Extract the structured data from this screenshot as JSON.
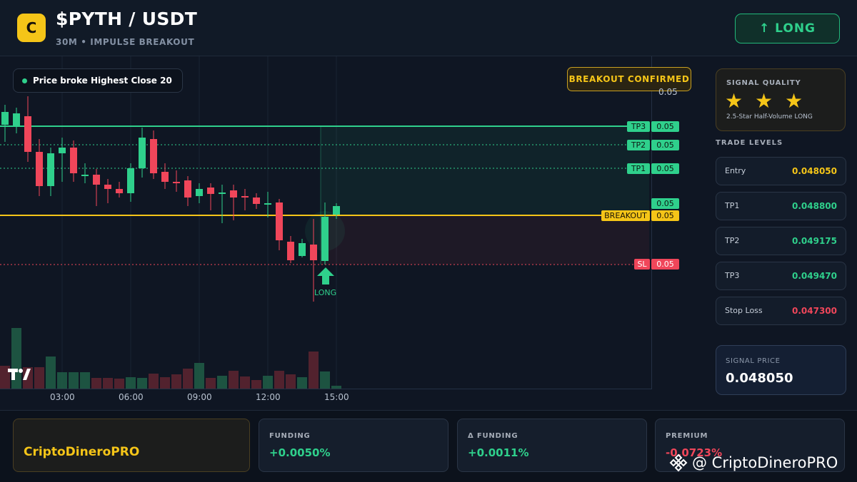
{
  "header": {
    "logo_letter": "C",
    "pair": "$PYTH / USDT",
    "subtitle": "30M • IMPULSE BREAKOUT",
    "direction_button": "↑ LONG"
  },
  "chart": {
    "notice": "Price broke Highest Close 20",
    "badge": "BREAKOUT CONFIRMED",
    "top_price_label": "0.05",
    "time_ticks": [
      "03:00",
      "06:00",
      "09:00",
      "12:00",
      "15:00"
    ],
    "lines": [
      {
        "name": "TP3",
        "label": "TP3",
        "value": "0.05",
        "color": "#2fd08c"
      },
      {
        "name": "TP2",
        "label": "TP2",
        "value": "0.05",
        "color": "#2fd08c"
      },
      {
        "name": "TP1",
        "label": "TP1",
        "value": "0.05",
        "color": "#2fd08c"
      },
      {
        "name": "breakout",
        "label": "BREAKOUT",
        "value": "0.05",
        "color": "#f5c518"
      },
      {
        "name": "sl",
        "label": "SL",
        "value": "0.05",
        "color": "#f0465a"
      }
    ],
    "current_price_label": "0.05",
    "signal_marker": "LONG",
    "tv_logo": "TV"
  },
  "right_panel": {
    "quality_title": "SIGNAL QUALITY",
    "stars": "★ ★ ★",
    "quality_desc": "2.5-Star Half-Volume LONG",
    "levels_title": "TRADE LEVELS",
    "levels": [
      {
        "label": "Entry",
        "value": "0.048050",
        "color": "#f5c518"
      },
      {
        "label": "TP1",
        "value": "0.048800",
        "color": "#2fd08c"
      },
      {
        "label": "TP2",
        "value": "0.049175",
        "color": "#2fd08c"
      },
      {
        "label": "TP3",
        "value": "0.049470",
        "color": "#2fd08c"
      },
      {
        "label": "Stop Loss",
        "value": "0.047300",
        "color": "#f0465a"
      }
    ],
    "signal_price_title": "SIGNAL PRICE",
    "signal_price": "0.048050"
  },
  "footer": {
    "brand": "CriptoDineroPRO",
    "stats": [
      {
        "label": "FUNDING",
        "value": "+0.0050%",
        "color": "#2fd08c"
      },
      {
        "label": "Δ FUNDING",
        "value": "+0.0011%",
        "color": "#2fd08c"
      },
      {
        "label": "PREMIUM",
        "value": "-0.0723%",
        "color": "#f0465a"
      }
    ],
    "watermark": "@ CriptoDineroPRO"
  },
  "colors": {
    "bull": "#2fd08c",
    "bear": "#f0465a",
    "accent": "#f5c518",
    "background": "#0f1623"
  }
}
